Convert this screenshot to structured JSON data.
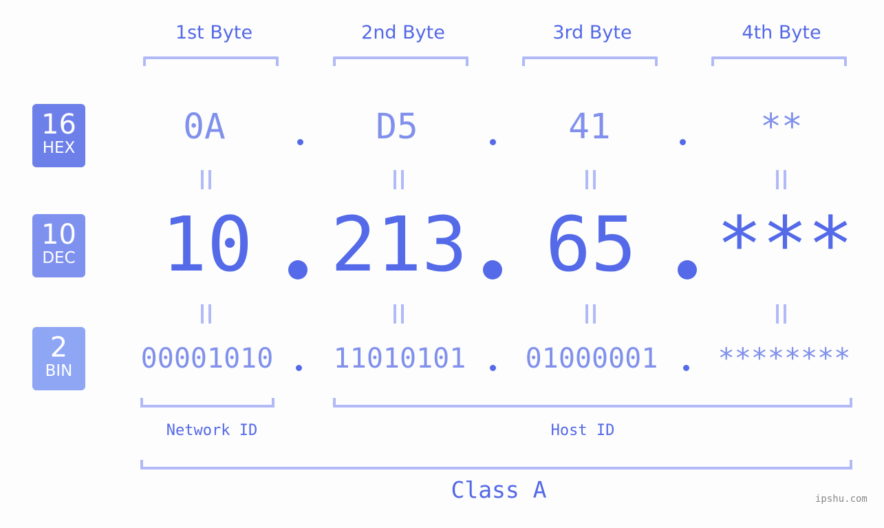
{
  "bytes": [
    {
      "label": "1st Byte",
      "hex": "0A",
      "dec": "10",
      "bin": "00001010"
    },
    {
      "label": "2nd Byte",
      "hex": "D5",
      "dec": "213",
      "bin": "11010101"
    },
    {
      "label": "3rd Byte",
      "hex": "41",
      "dec": "65",
      "bin": "01000001"
    },
    {
      "label": "4th Byte",
      "hex": "**",
      "dec": "***",
      "bin": "********"
    }
  ],
  "bases": {
    "hex": {
      "number": "16",
      "label": "HEX",
      "color": "#6d7fe9"
    },
    "dec": {
      "number": "10",
      "label": "DEC",
      "color": "#7f91ee"
    },
    "bin": {
      "number": "2",
      "label": "BIN",
      "color": "#8fa6f5"
    }
  },
  "segments": {
    "network": "Network ID",
    "host": "Host ID",
    "class": "Class A"
  },
  "colors": {
    "accent": "#546ae8",
    "light_value": "#8090ec",
    "bracket": "#b1baf7",
    "background": "#fcfdfc"
  },
  "watermark": "ipshu.com"
}
